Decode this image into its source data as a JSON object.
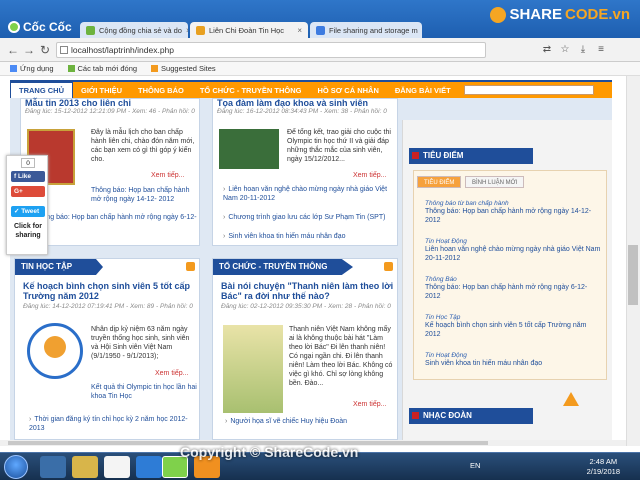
{
  "browser": {
    "brand": "Cốc Cốc",
    "tabs": [
      {
        "label": "Cộng đồng chia sẻ và do",
        "active": false,
        "color": "#6db33f"
      },
      {
        "label": "Liên Chi Đoàn Tin Học",
        "active": true,
        "color": "#e8a020"
      },
      {
        "label": "File sharing and storage m",
        "active": false,
        "color": "#3d7be0"
      }
    ],
    "watermark_logo": {
      "prefix": "SHARE",
      "suffix": "CODE.vn"
    },
    "url": "localhost/laptrinh/index.php",
    "bookmarks": [
      {
        "label": "Ứng dụng",
        "color": "#4c8bf5"
      },
      {
        "label": "Các tab mới đóng",
        "color": "#6db33f"
      },
      {
        "label": "Suggested Sites",
        "color": "#f39a1e"
      }
    ]
  },
  "site": {
    "nav": [
      "TRANG CHỦ",
      "GIỚI THIỆU",
      "THÔNG BÁO",
      "TỔ CHỨC - TRUYỀN THÔNG",
      "HỒ SƠ CÁ NHÂN",
      "ĐĂNG BÀI VIẾT"
    ],
    "top_left": {
      "title": "Mẫu tin 2013 cho liên chi",
      "meta": "Đăng lúc: 15-12-2012 12:21:09 PM - Xem: 46 - Phản hồi: 0",
      "body": "Đây là mẫu lịch cho ban chấp hành liên chi, chào đón năm mới, các bạn xem có gì thì góp ý kiến cho.",
      "more": "Xem tiếp...",
      "related": [
        "Thông báo: Họp ban chấp hành mở rộng ngày 14-12- 2012",
        "Thông báo: Họp ban chấp hành mở rộng ngày 6-12-2012"
      ]
    },
    "top_middle": {
      "title": "Tọa đàm làm đạo khoa và sinh viên",
      "meta": "Đăng lúc: 16-12-2012 08:34:43 PM - Xem: 38 - Phản hồi: 0",
      "body": "Để tổng kết, trao giải cho cuộc thi Olympic tin học thứ II và giải đáp những thắc mắc của sinh viên, ngày 15/12/2012...",
      "more": "Xem tiếp...",
      "related": [
        "Liên hoan văn nghệ chào mừng ngày nhà giáo Việt Nam 20-11-2012",
        "Chương trình giao lưu các lớp Sư Phạm Tin (SPT)",
        "Sinh viên khoa tin hiến máu nhân đạo"
      ]
    },
    "share": {
      "count": "0",
      "like": "Like",
      "gplus": "G+",
      "tweet": "Tweet",
      "caption": "Click for sharing"
    },
    "section_left": {
      "heading": "TIN HỌC TẬP",
      "title": "Kế hoạch bình chọn sinh viên 5 tốt cấp Trường năm 2012",
      "meta": "Đăng lúc: 14-12-2012 07:19:41 PM - Xem: 89 - Phản hồi: 0",
      "body": "Nhân dịp kỷ niệm 63 năm ngày truyền thống học sinh, sinh viên và Hội Sinh viên Việt Nam (9/1/1950 - 9/1/2013);",
      "more": "Xem tiếp...",
      "related": [
        "Kết quả thi Olympic tin học lần hai khoa Tin Học",
        "Thời gian đăng ký tín chỉ học kỳ 2 năm học 2012-2013"
      ]
    },
    "section_middle": {
      "heading": "TỔ CHỨC - TRUYỀN THÔNG",
      "title": "Bài nói chuyện \"Thanh niên làm theo lời Bác\" ra đời như thế nào?",
      "meta": "Đăng lúc: 02-12-2012 09:35:30 PM - Xem: 28 - Phản hồi: 0",
      "body": "Thanh niên Việt Nam không mấy ai là không thuộc bài hát \"Làm theo lời Bác\" Ði lên thanh niên! Có ngại ngần chi. Ði lên thanh niên! Làm theo lời Bác. Không có việc gì khó. Chỉ sợ lòng không bền. Ðào...",
      "more": "Xem tiếp...",
      "related": [
        "Người họa sĩ vẽ chiếc Huy hiệu Đoàn"
      ]
    },
    "sidebar": {
      "heading": "TIÊU ĐIỂM",
      "tabs": [
        "TIÊU ĐIỂM",
        "BÌNH LUẬN MỚI"
      ],
      "items": [
        {
          "cat": "Thông báo từ ban chấp hành",
          "text": "Thông báo: Họp ban chấp hành mở rộng ngày 14-12- 2012"
        },
        {
          "cat": "Tin Hoạt Động",
          "text": "Liên hoan văn nghệ chào mừng ngày nhà giáo Việt Nam 20-11-2012"
        },
        {
          "cat": "Thông Báo",
          "text": "Thông báo: Họp ban chấp hành mở rộng ngày 6-12- 2012"
        },
        {
          "cat": "Tin Học Tập",
          "text": "Kế hoạch bình chọn sinh viên 5 tốt cấp Trường năm 2012"
        },
        {
          "cat": "Tin Hoạt Động",
          "text": "Sinh viên khoa tin hiến máu nhân đạo"
        }
      ],
      "heading2": "NHẠC ĐOÀN"
    }
  },
  "taskbar": {
    "time": "2:48 AM",
    "date": "2/19/2018",
    "lang": "EN"
  },
  "watermark": "Copyright © ShareCode.vn",
  "colors": {
    "accent": "#1f4e9a",
    "nav": "#ff9900",
    "link": "#1f4e9a"
  }
}
